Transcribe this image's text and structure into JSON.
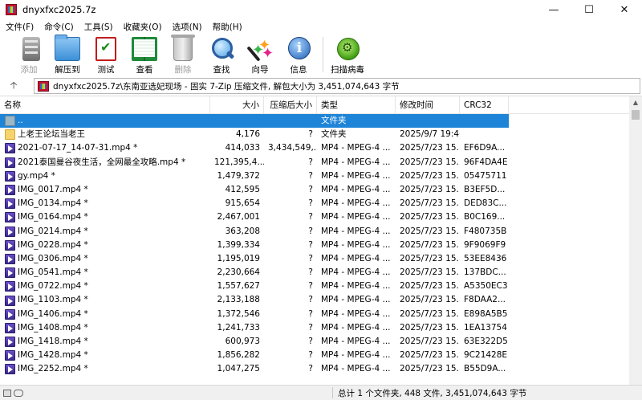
{
  "window": {
    "title": "dnyxfxc2025.7z",
    "minimize_glyph": "—",
    "maximize_glyph": "☐",
    "close_glyph": "✕"
  },
  "menu": [
    "文件(F)",
    "命令(C)",
    "工具(S)",
    "收藏夹(O)",
    "选项(N)",
    "帮助(H)"
  ],
  "toolbar": {
    "buttons": [
      {
        "label": "添加",
        "icon": "add-archive-icon",
        "enabled": false
      },
      {
        "label": "解压到",
        "icon": "extract-folder-icon",
        "enabled": true
      },
      {
        "label": "测试",
        "icon": "test-checkmark-icon",
        "enabled": true
      },
      {
        "label": "查看",
        "icon": "view-book-icon",
        "enabled": true
      },
      {
        "label": "删除",
        "icon": "delete-trash-icon",
        "enabled": false
      },
      {
        "label": "查找",
        "icon": "find-magnifier-icon",
        "enabled": true
      },
      {
        "label": "向导",
        "icon": "wizard-wand-icon",
        "enabled": true
      },
      {
        "label": "信息",
        "icon": "info-icon",
        "enabled": true
      },
      {
        "label": "扫描病毒",
        "icon": "virus-scan-icon",
        "enabled": true
      }
    ]
  },
  "address": {
    "up_glyph": "🡡",
    "path": "dnyxfxc2025.7z\\东南亚选妃现场 - 固实 7-Zip 压缩文件, 解包大小为 3,451,074,643 字节"
  },
  "columns": {
    "name": "名称",
    "size": "大小",
    "packed": "压缩后大小",
    "type": "类型",
    "modified": "修改时间",
    "crc": "CRC32"
  },
  "rows": [
    {
      "icon": "up",
      "name": "..",
      "size": "",
      "packed": "",
      "type": "文件夹",
      "modified": "",
      "crc": "",
      "selected": true
    },
    {
      "icon": "folder",
      "name": "上老王论坛当老王",
      "size": "4,176",
      "packed": "?",
      "type": "文件夹",
      "modified": "2025/9/7 19:46",
      "crc": ""
    },
    {
      "icon": "video",
      "name": "2021-07-17_14-07-31.mp4 *",
      "size": "414,033",
      "packed": "3,434,549,...",
      "type": "MP4 - MPEG-4 ...",
      "modified": "2025/7/23 15...",
      "crc": "EF6D9A..."
    },
    {
      "icon": "video",
      "name": "2021泰国曼谷夜生活，全网最全攻略.mp4 *",
      "size": "121,395,4...",
      "packed": "?",
      "type": "MP4 - MPEG-4 ...",
      "modified": "2025/7/23 15...",
      "crc": "96F4DA4E"
    },
    {
      "icon": "video",
      "name": "gy.mp4 *",
      "size": "1,479,372",
      "packed": "?",
      "type": "MP4 - MPEG-4 ...",
      "modified": "2025/7/23 15...",
      "crc": "05475711"
    },
    {
      "icon": "video",
      "name": "IMG_0017.mp4 *",
      "size": "412,595",
      "packed": "?",
      "type": "MP4 - MPEG-4 ...",
      "modified": "2025/7/23 15...",
      "crc": "B3EF5D..."
    },
    {
      "icon": "video",
      "name": "IMG_0134.mp4 *",
      "size": "915,654",
      "packed": "?",
      "type": "MP4 - MPEG-4 ...",
      "modified": "2025/7/23 15...",
      "crc": "DED83C..."
    },
    {
      "icon": "video",
      "name": "IMG_0164.mp4 *",
      "size": "2,467,001",
      "packed": "?",
      "type": "MP4 - MPEG-4 ...",
      "modified": "2025/7/23 15...",
      "crc": "B0C169..."
    },
    {
      "icon": "video",
      "name": "IMG_0214.mp4 *",
      "size": "363,208",
      "packed": "?",
      "type": "MP4 - MPEG-4 ...",
      "modified": "2025/7/23 15...",
      "crc": "F480735B"
    },
    {
      "icon": "video",
      "name": "IMG_0228.mp4 *",
      "size": "1,399,334",
      "packed": "?",
      "type": "MP4 - MPEG-4 ...",
      "modified": "2025/7/23 15...",
      "crc": "9F9069F9"
    },
    {
      "icon": "video",
      "name": "IMG_0306.mp4 *",
      "size": "1,195,019",
      "packed": "?",
      "type": "MP4 - MPEG-4 ...",
      "modified": "2025/7/23 15...",
      "crc": "53EE8436"
    },
    {
      "icon": "video",
      "name": "IMG_0541.mp4 *",
      "size": "2,230,664",
      "packed": "?",
      "type": "MP4 - MPEG-4 ...",
      "modified": "2025/7/23 15...",
      "crc": "137BDC..."
    },
    {
      "icon": "video",
      "name": "IMG_0722.mp4 *",
      "size": "1,557,627",
      "packed": "?",
      "type": "MP4 - MPEG-4 ...",
      "modified": "2025/7/23 15...",
      "crc": "A5350EC3"
    },
    {
      "icon": "video",
      "name": "IMG_1103.mp4 *",
      "size": "2,133,188",
      "packed": "?",
      "type": "MP4 - MPEG-4 ...",
      "modified": "2025/7/23 15...",
      "crc": "F8DAA2..."
    },
    {
      "icon": "video",
      "name": "IMG_1406.mp4 *",
      "size": "1,372,546",
      "packed": "?",
      "type": "MP4 - MPEG-4 ...",
      "modified": "2025/7/23 15...",
      "crc": "E898A5B5"
    },
    {
      "icon": "video",
      "name": "IMG_1408.mp4 *",
      "size": "1,241,733",
      "packed": "?",
      "type": "MP4 - MPEG-4 ...",
      "modified": "2025/7/23 15...",
      "crc": "1EA13754"
    },
    {
      "icon": "video",
      "name": "IMG_1418.mp4 *",
      "size": "600,973",
      "packed": "?",
      "type": "MP4 - MPEG-4 ...",
      "modified": "2025/7/23 15...",
      "crc": "63E322D5"
    },
    {
      "icon": "video",
      "name": "IMG_1428.mp4 *",
      "size": "1,856,282",
      "packed": "?",
      "type": "MP4 - MPEG-4 ...",
      "modified": "2025/7/23 15...",
      "crc": "9C21428E"
    },
    {
      "icon": "video",
      "name": "IMG_2252.mp4 *",
      "size": "1,047,275",
      "packed": "?",
      "type": "MP4 - MPEG-4 ...",
      "modified": "2025/7/23 15...",
      "crc": "B55D9A..."
    }
  ],
  "scrollbar": {
    "up_glyph": "▲"
  },
  "status": {
    "text": "总计 1 个文件夹, 448 文件, 3,451,074,643 字节"
  },
  "colors": {
    "selection": "#1e84d8",
    "folder": "#f7d36b",
    "video_icon": "#4b35a8"
  }
}
